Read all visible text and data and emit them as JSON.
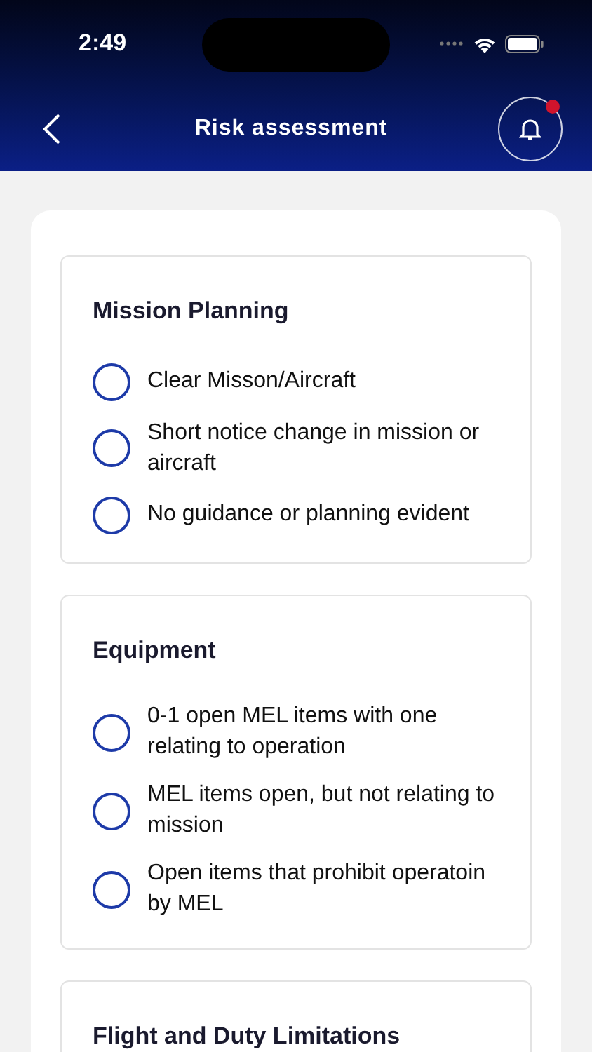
{
  "status_bar": {
    "time": "2:49"
  },
  "header": {
    "title": "Risk assessment",
    "notification_dot": true
  },
  "sections": [
    {
      "title": "Mission Planning",
      "options": [
        {
          "label": "Clear Misson/Aircraft",
          "selected": false
        },
        {
          "label": "Short notice change in mission or aircraft",
          "selected": false
        },
        {
          "label": "No guidance or planning evident",
          "selected": false
        }
      ]
    },
    {
      "title": "Equipment",
      "options": [
        {
          "label": "0-1 open MEL items with one relating to operation",
          "selected": false
        },
        {
          "label": "MEL items open, but not relating to mission",
          "selected": false
        },
        {
          "label": "Open items that prohibit operatoin by MEL",
          "selected": false
        }
      ]
    },
    {
      "title": "Flight and Duty Limitations"
    }
  ]
}
